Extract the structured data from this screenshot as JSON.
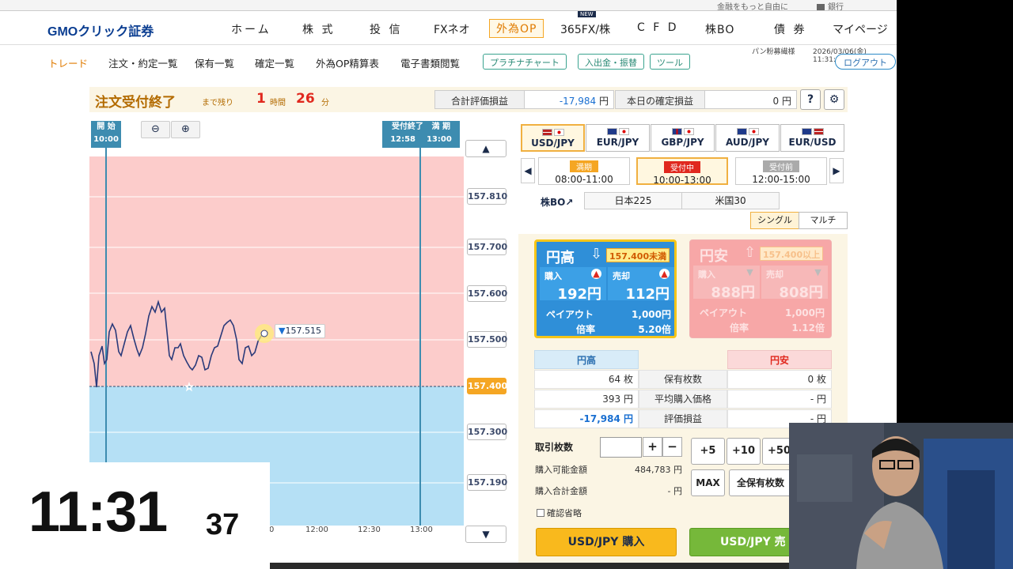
{
  "top_strip": {
    "link_more": "金融をもっと自由に",
    "bank": "銀行"
  },
  "logo": "GMOクリック証券",
  "main_nav": [
    "ホーム",
    "株 式",
    "投 信",
    "FXネオ",
    "外為OP",
    "365FX/株",
    "C F D",
    "株BO",
    "債 券",
    "マイページ"
  ],
  "main_nav_active": "外為OP",
  "new_badge": "NEW",
  "sub_nav": [
    "トレード",
    "注文・約定一覧",
    "保有一覧",
    "確定一覧",
    "外為OP精算表",
    "電子書類閲覧"
  ],
  "sub_buttons": [
    "プラチナチャート",
    "入出金・振替",
    "ツール"
  ],
  "user": "パン粉募繊様",
  "datetime": "2026/03/06(金) 11:31:36",
  "logout": "ログアウト",
  "status": {
    "title": "注文受付終了",
    "remaining_label": "まで残り",
    "hours": "1",
    "hours_unit": "時間",
    "minutes": "26",
    "minutes_unit": "分",
    "total_label": "合計評価損益",
    "total_value": "-17,984",
    "total_unit": "円",
    "today_label": "本日の確定損益",
    "today_value": "0",
    "today_unit": "円",
    "help": "?",
    "settings": "⚙"
  },
  "chart": {
    "start_label": "開 始",
    "start_time": "10:00",
    "end_label": "受付終了",
    "end_time": "12:58",
    "expiry_label": "満 期",
    "expiry_time": "13:00",
    "y_ticks": [
      "157.810",
      "157.700",
      "157.600",
      "157.500",
      "157.400",
      "157.300",
      "157.190"
    ],
    "current_price_label": "157.400",
    "last_price": "157.515",
    "x_ticks": [
      "0",
      "12:00",
      "12:30",
      "13:00"
    ],
    "up_arrow": "▲",
    "down_arrow": "▼"
  },
  "clock": {
    "hm": "11:31",
    "sec": "37"
  },
  "currency_tabs": [
    "USD/JPY",
    "EUR/JPY",
    "GBP/JPY",
    "AUD/JPY",
    "EUR/USD"
  ],
  "currency_active": "USD/JPY",
  "sessions": [
    {
      "badge": "満期",
      "time": "08:00-11:00"
    },
    {
      "badge": "受付中",
      "time": "10:00-13:00"
    },
    {
      "badge": "受付前",
      "time": "12:00-15:00"
    }
  ],
  "kabubo_label": "株BO↗",
  "index_buttons": [
    "日本225",
    "米国30"
  ],
  "modes": [
    "シングル",
    "マルチ"
  ],
  "card_up": {
    "title": "円高",
    "arrow": "⇩",
    "cond": "157.400未満",
    "buy_label": "購入",
    "buy_value": "192円",
    "sell_label": "売却",
    "sell_value": "112円",
    "payout_label": "ペイアウト",
    "payout_value": "1,000円",
    "rate_label": "倍率",
    "rate_value": "5.20倍"
  },
  "card_down": {
    "title": "円安",
    "arrow": "⇧",
    "cond": "157.400以上",
    "buy_label": "購入",
    "buy_value": "888円",
    "sell_label": "売却",
    "sell_value": "808円",
    "payout_label": "ペイアウト",
    "payout_value": "1,000円",
    "rate_label": "倍率",
    "rate_value": "1.12倍"
  },
  "positions": {
    "up_header": "円高",
    "down_header": "円安",
    "rows": [
      {
        "up": "64 枚",
        "label": "保有枚数",
        "down": "0 枚"
      },
      {
        "up": "393 円",
        "label": "平均購入価格",
        "down": "- 円"
      },
      {
        "up": "-17,984 円",
        "label": "評価損益",
        "down": "- 円"
      }
    ]
  },
  "qty": {
    "label": "取引枚数",
    "plus": "+",
    "minus": "−",
    "steps": [
      "+5",
      "+10",
      "+50"
    ],
    "available_label": "購入可能金額",
    "available_value": "484,783 円",
    "total_label": "購入合計金額",
    "total_value": "- 円",
    "max": "MAX",
    "all": "全保有枚数",
    "confirm": "確認省略"
  },
  "buy_button": "USD/JPY 購入",
  "sell_button": "USD/JPY 売",
  "colors": {
    "accent": "#f5a623",
    "up_blue": "#2f8fd8",
    "down_red": "#f7a7a7",
    "buy_yellow": "#f9b91d",
    "sell_green": "#76b83a"
  }
}
